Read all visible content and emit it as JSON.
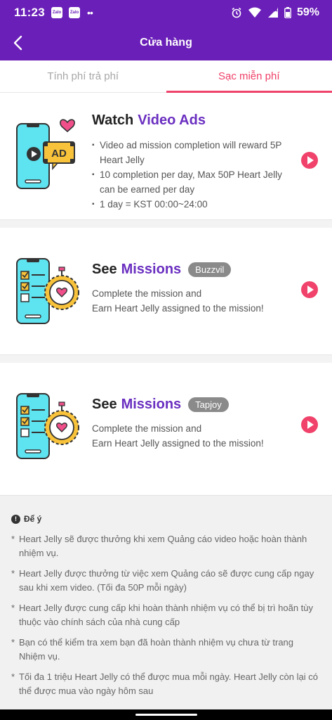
{
  "status": {
    "time": "11:23",
    "zalo": "Zalo",
    "dots": "••",
    "battery": "59%"
  },
  "header": {
    "title": "Cửa hàng"
  },
  "tabs": [
    {
      "label": "Tính phí trả phí",
      "active": false
    },
    {
      "label": "Sạc miễn phí",
      "active": true
    }
  ],
  "cards": [
    {
      "title_prefix": "Watch",
      "title_highlight": "Video Ads",
      "bullets": [
        "Video ad mission completion will reward 5P Heart Jelly",
        "10 completion per day, Max 50P Heart Jelly can be earned per day",
        "1 day = KST 00:00~24:00"
      ]
    },
    {
      "title_prefix": "See",
      "title_highlight": "Missions",
      "badge": "Buzzvil",
      "desc": [
        "Complete the mission and",
        "Earn Heart Jelly assigned to the mission!"
      ]
    },
    {
      "title_prefix": "See",
      "title_highlight": "Missions",
      "badge": "Tapjoy",
      "desc": [
        "Complete the mission and",
        "Earn Heart Jelly assigned to the mission!"
      ]
    }
  ],
  "notice": {
    "title": "Để ý",
    "items": [
      "Heart Jelly sẽ được thưởng khi xem Quảng cáo video hoặc hoàn thành nhiệm vụ.",
      "Heart Jelly được thưởng từ việc xem Quảng cáo sẽ được cung cấp ngay sau khi xem video. (Tối đa 50P mỗi ngày)",
      "Heart Jelly được cung cấp khi hoàn thành nhiệm vụ có thể bị trì hoãn tùy thuộc vào chính sách của nhà cung cấp",
      "Bạn có thể kiểm tra xem bạn đã hoàn thành nhiệm vụ chưa từ trang Nhiệm vụ.",
      "Tối đa 1 triệu Heart Jelly có thể được mua mỗi ngày. Heart Jelly còn lại có thể được mua vào ngày hôm sau"
    ]
  },
  "colors": {
    "primary": "#6a1fb8",
    "accent": "#f0426a",
    "highlight": "#6a2fc0",
    "badge": "#8a8a8a"
  },
  "icons": [
    "back-arrow-icon",
    "alarm-icon",
    "wifi-icon",
    "signal-icon",
    "battery-icon",
    "play-icon",
    "info-icon"
  ]
}
